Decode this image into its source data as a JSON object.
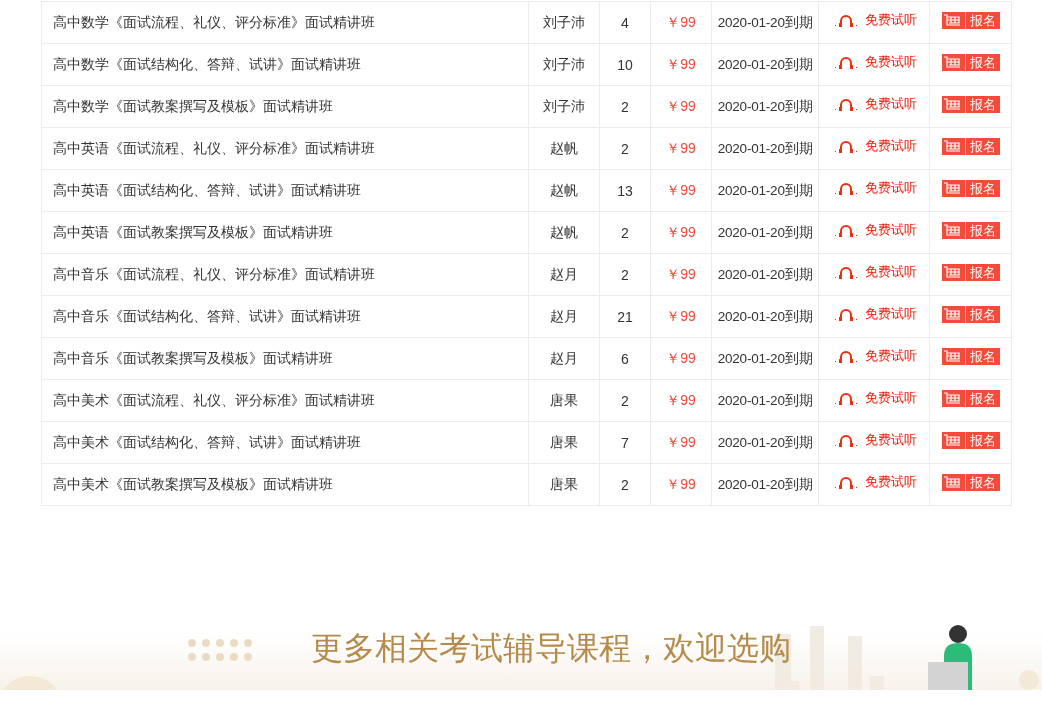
{
  "courses": [
    {
      "name": "高中数学《面试流程、礼仪、评分标准》面试精讲班",
      "teacher": "刘子沛",
      "count": "4",
      "price": "￥99",
      "expiry": "2020-01-20到期",
      "trial": "免费试听",
      "signup": "报名"
    },
    {
      "name": "高中数学《面试结构化、答辩、试讲》面试精讲班",
      "teacher": "刘子沛",
      "count": "10",
      "price": "￥99",
      "expiry": "2020-01-20到期",
      "trial": "免费试听",
      "signup": "报名"
    },
    {
      "name": "高中数学《面试教案撰写及模板》面试精讲班",
      "teacher": "刘子沛",
      "count": "2",
      "price": "￥99",
      "expiry": "2020-01-20到期",
      "trial": "免费试听",
      "signup": "报名"
    },
    {
      "name": "高中英语《面试流程、礼仪、评分标准》面试精讲班",
      "teacher": "赵帆",
      "count": "2",
      "price": "￥99",
      "expiry": "2020-01-20到期",
      "trial": "免费试听",
      "signup": "报名"
    },
    {
      "name": "高中英语《面试结构化、答辩、试讲》面试精讲班",
      "teacher": "赵帆",
      "count": "13",
      "price": "￥99",
      "expiry": "2020-01-20到期",
      "trial": "免费试听",
      "signup": "报名"
    },
    {
      "name": "高中英语《面试教案撰写及模板》面试精讲班",
      "teacher": "赵帆",
      "count": "2",
      "price": "￥99",
      "expiry": "2020-01-20到期",
      "trial": "免费试听",
      "signup": "报名"
    },
    {
      "name": "高中音乐《面试流程、礼仪、评分标准》面试精讲班",
      "teacher": "赵月",
      "count": "2",
      "price": "￥99",
      "expiry": "2020-01-20到期",
      "trial": "免费试听",
      "signup": "报名"
    },
    {
      "name": "高中音乐《面试结构化、答辩、试讲》面试精讲班",
      "teacher": "赵月",
      "count": "21",
      "price": "￥99",
      "expiry": "2020-01-20到期",
      "trial": "免费试听",
      "signup": "报名"
    },
    {
      "name": "高中音乐《面试教案撰写及模板》面试精讲班",
      "teacher": "赵月",
      "count": "6",
      "price": "￥99",
      "expiry": "2020-01-20到期",
      "trial": "免费试听",
      "signup": "报名"
    },
    {
      "name": "高中美术《面试流程、礼仪、评分标准》面试精讲班",
      "teacher": "唐果",
      "count": "2",
      "price": "￥99",
      "expiry": "2020-01-20到期",
      "trial": "免费试听",
      "signup": "报名"
    },
    {
      "name": "高中美术《面试结构化、答辩、试讲》面试精讲班",
      "teacher": "唐果",
      "count": "7",
      "price": "￥99",
      "expiry": "2020-01-20到期",
      "trial": "免费试听",
      "signup": "报名"
    },
    {
      "name": "高中美术《面试教案撰写及模板》面试精讲班",
      "teacher": "唐果",
      "count": "2",
      "price": "￥99",
      "expiry": "2020-01-20到期",
      "trial": "免费试听",
      "signup": "报名"
    }
  ],
  "banner": {
    "heading": "更多相关考试辅导课程，欢迎选购"
  }
}
